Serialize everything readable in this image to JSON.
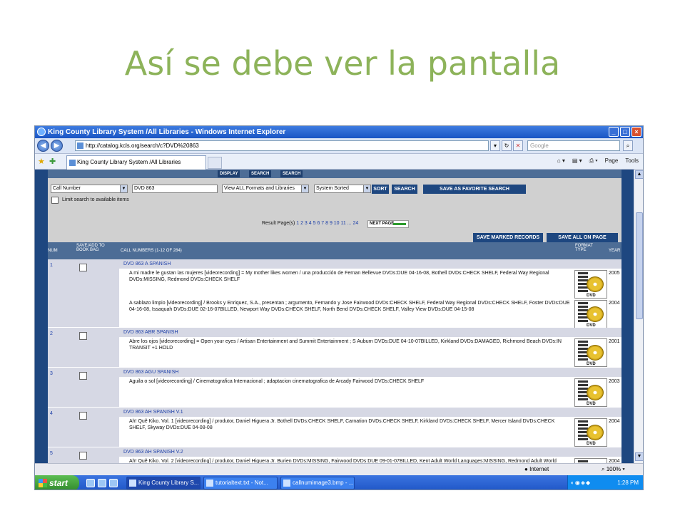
{
  "slide": {
    "title": "Así se debe ver la pantalla"
  },
  "window": {
    "title": "King County Library System /All Libraries - Windows Internet Explorer"
  },
  "browser": {
    "url": "http://catalog.kcls.org/search/c?DVD%20863",
    "search_placeholder": "Google",
    "tab_label": "King County Library System /All Libraries",
    "tools": [
      "Page",
      "Tools"
    ]
  },
  "catalog": {
    "top_buttons": [
      "DISPLAY",
      "SEARCH",
      "SEARCH"
    ],
    "search_type": "Call Number",
    "search_value": "DVD 863",
    "format_select": "View ALL Formats and Libraries",
    "sort_select": "System Sorted",
    "sort_button": "SORT",
    "search_button": "SEARCH",
    "favorite_button": "SAVE AS FAVORITE SEARCH",
    "limit_label": "Limit search to available items",
    "result_pages_label": "Result Page(s)",
    "result_pages": "1 2 3 4 5 6 7 8 9 10 11 ... 24",
    "next_page": "NEXT PAGE",
    "save_marked": "SAVE MARKED RECORDS",
    "save_all": "SAVE ALL ON PAGE",
    "headers": {
      "num": "NUM",
      "save": "SAVE/ADD TO BOOK BAG",
      "call": "CALL NUMBERS (1-12 OF 284)",
      "format": "FORMAT TYPE",
      "year": "YEAR"
    },
    "records": [
      {
        "num": "1",
        "call": "DVD 863 A SPANISH",
        "items": [
          {
            "text": "A mi madre le gustan las mujeres [videorecording] = My mother likes women / una producción de Fernan Bellevue DVDs:DUE 04-16-08, Bothell DVDs:CHECK SHELF, Federal Way Regional DVDs:MISSING, Redmond DVDs:CHECK SHELF",
            "year": "2005"
          },
          {
            "text": "A sablazo limpio [videorecording] / Brooks y Enriquez, S.A., presentan ; argumento, Fernando y Jose Fairwood DVDs:CHECK SHELF, Federal Way Regional DVDs:CHECK SHELF, Foster DVDs:DUE 04-16-08, Issaquah DVDs:DUE 02-16-07BILLED, Newport Way DVDs:CHECK SHELF, North Bend DVDs:CHECK SHELF, Valley View DVDs:DUE 04-15-08",
            "year": "2004"
          }
        ]
      },
      {
        "num": "2",
        "call": "DVD 863 ABR SPANISH",
        "items": [
          {
            "text": "Abre los ojos [videorecording] = Open your eyes / Artisan Entertainment and Summit Entertainment ; S Auburn DVDs:DUE 04-10-07BILLED, Kirkland DVDs:DAMAGED, Richmond Beach DVDs:IN TRANSIT +1 HOLD",
            "year": "2001"
          }
        ]
      },
      {
        "num": "3",
        "call": "DVD 863 AGU SPANISH",
        "items": [
          {
            "text": "Aguila o sol [videorecording] / Cinematografica Internacional ; adaptacion cinematografica de Arcady Fairwood DVDs:CHECK SHELF",
            "year": "2003"
          }
        ]
      },
      {
        "num": "4",
        "call": "DVD 863 AH SPANISH V.1",
        "items": [
          {
            "text": "Ah! Quê Kiko. Vol. 1 [videorecording] / produtor, Daniel Higuera Jr. Bothell DVDs:CHECK SHELF, Carnation DVDs:CHECK SHELF, Kirkland DVDs:CHECK SHELF, Mercer Island DVDs:CHECK SHELF, Skyway DVDs:DUE 04-08-08",
            "year": "2004"
          }
        ]
      },
      {
        "num": "5",
        "call": "DVD 863 AH SPANISH V.2",
        "items": [
          {
            "text": "Ah! Quê Kiko. Vol. 2 [videorecording] / produtor, Daniel Higuera Jr. Burien DVDs:MISSING, Fairwood DVDs:DUE 09-01-07BILLED, Kent Adult World Languages:MISSING, Redmond Adult World Languages:CHECK SHELF",
            "year": "2004"
          }
        ]
      }
    ],
    "dvd_label": "DVD"
  },
  "statusbar": {
    "zone": "Internet",
    "zoom": "100%"
  },
  "taskbar": {
    "start": "start",
    "tasks": [
      "King County Library S...",
      "tutorialtext.txt - Not...",
      "callnumimage3.bmp - ..."
    ],
    "time": "1:28 PM"
  }
}
